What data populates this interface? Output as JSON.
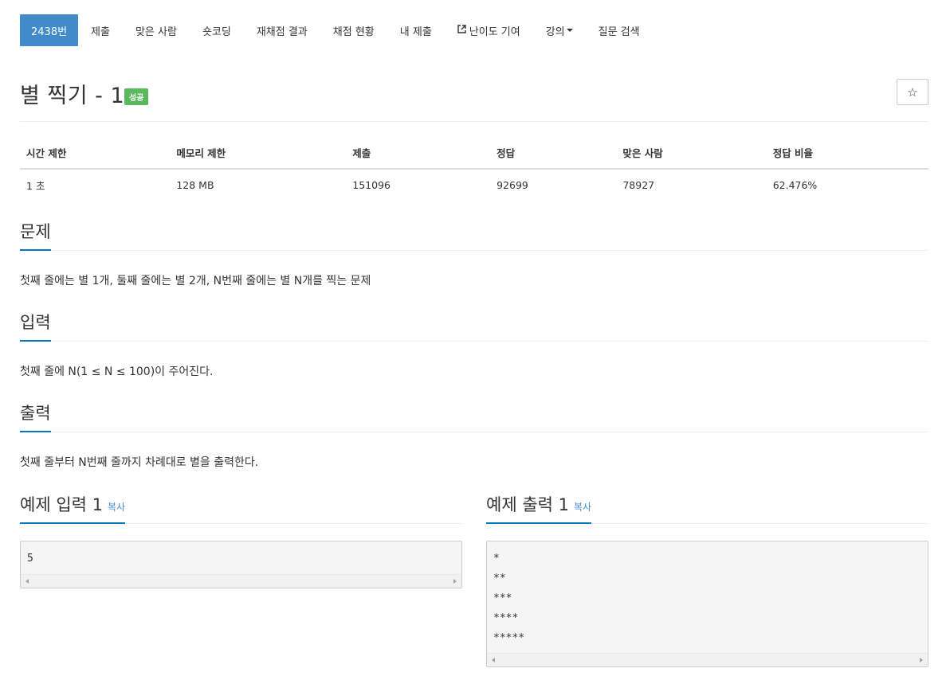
{
  "nav": {
    "items": [
      {
        "label": "2438번",
        "active": true
      },
      {
        "label": "제출"
      },
      {
        "label": "맞은 사람"
      },
      {
        "label": "숏코딩"
      },
      {
        "label": "재채점 결과"
      },
      {
        "label": "채점 현황"
      },
      {
        "label": "내 제출"
      },
      {
        "label": "난이도 기여",
        "icon": "external-link-icon"
      },
      {
        "label": "강의",
        "icon": "caret-down-icon"
      },
      {
        "label": "질문 검색"
      }
    ]
  },
  "problem": {
    "title": "별 찍기 - 1",
    "status_badge": "성공",
    "star_icon": "☆"
  },
  "info_table": {
    "headers": [
      "시간 제한",
      "메모리 제한",
      "제출",
      "정답",
      "맞은 사람",
      "정답 비율"
    ],
    "values": [
      "1 초",
      "128 MB",
      "151096",
      "92699",
      "78927",
      "62.476%"
    ]
  },
  "sections": {
    "description": {
      "heading": "문제",
      "text": "첫째 줄에는 별 1개, 둘째 줄에는 별 2개, N번째 줄에는 별 N개를 찍는 문제"
    },
    "input": {
      "heading": "입력",
      "text": "첫째 줄에 N(1 ≤ N ≤ 100)이 주어진다."
    },
    "output": {
      "heading": "출력",
      "text": "첫째 줄부터 N번째 줄까지 차례대로 별을 출력한다."
    }
  },
  "samples": {
    "input": {
      "heading": "예제 입력 1",
      "copy_label": "복사",
      "lines": [
        "5"
      ]
    },
    "output": {
      "heading": "예제 출력 1",
      "copy_label": "복사",
      "lines": [
        "*",
        "**",
        "***",
        "****",
        "*****"
      ]
    }
  },
  "colors": {
    "accent": "#428bca",
    "success": "#5cb85c",
    "underline": "#0076c0"
  }
}
